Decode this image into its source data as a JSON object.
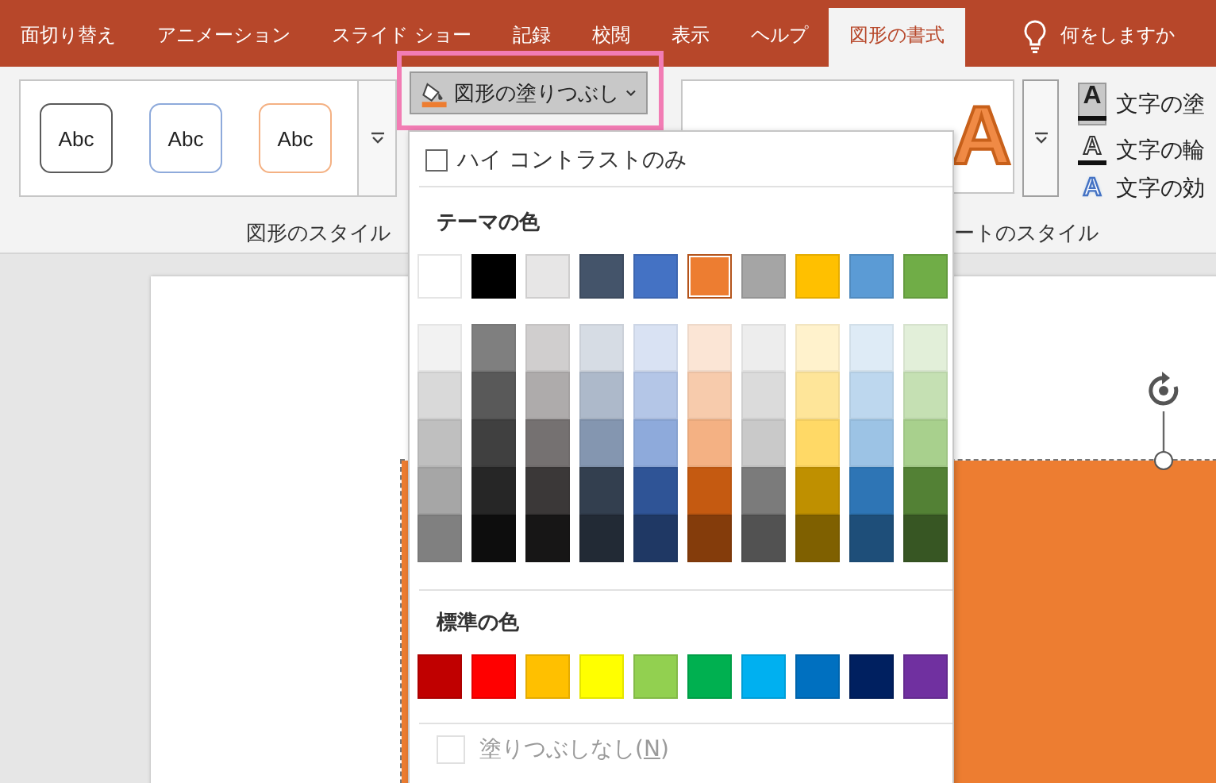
{
  "tabs": [
    {
      "label": "面切り替え",
      "selected": false
    },
    {
      "label": "アニメーション",
      "selected": false
    },
    {
      "label": "スライド ショー",
      "selected": false
    },
    {
      "label": "記録",
      "selected": false
    },
    {
      "label": "校閲",
      "selected": false
    },
    {
      "label": "表示",
      "selected": false
    },
    {
      "label": "ヘルプ",
      "selected": false
    },
    {
      "label": "図形の書式",
      "selected": true
    }
  ],
  "tell_me": {
    "label": "何をしますか"
  },
  "shape_styles": {
    "items": [
      {
        "label": "Abc",
        "color": "#5a5a5a"
      },
      {
        "label": "Abc",
        "color": "#8eaadb"
      },
      {
        "label": "Abc",
        "color": "#f4b183"
      }
    ],
    "group_label": "図形のスタイル"
  },
  "fill_button": {
    "label": "図形の塗りつぶし",
    "expanded": true
  },
  "wordart_styles": {
    "items": [
      {
        "label": "A"
      }
    ],
    "group_label": "ートのスタイル"
  },
  "text_commands": [
    {
      "kind": "fill",
      "glyph": "A",
      "label": "文字の塗"
    },
    {
      "kind": "outline",
      "glyph": "A",
      "label": "文字の輪"
    },
    {
      "kind": "effects",
      "glyph": "A",
      "label": "文字の効"
    }
  ],
  "fill_menu": {
    "high_contrast": {
      "label": "ハイ コントラストのみ",
      "checked": false
    },
    "theme_heading": "テーマの色",
    "theme_colors": [
      {
        "color": "#ffffff",
        "selected": false,
        "shades": [
          {
            "color": "#f2f2f2",
            "selected": false
          },
          {
            "color": "#d9d9d9",
            "selected": false
          },
          {
            "color": "#bfbfbf",
            "selected": false
          },
          {
            "color": "#a6a6a6",
            "selected": false
          },
          {
            "color": "#808080",
            "selected": false
          }
        ]
      },
      {
        "color": "#000000",
        "selected": false,
        "shades": [
          {
            "color": "#7f7f7f",
            "selected": false
          },
          {
            "color": "#595959",
            "selected": false
          },
          {
            "color": "#404040",
            "selected": false
          },
          {
            "color": "#262626",
            "selected": false
          },
          {
            "color": "#0d0d0d",
            "selected": false
          }
        ]
      },
      {
        "color": "#e7e6e6",
        "selected": false,
        "shades": [
          {
            "color": "#d0cece",
            "selected": false
          },
          {
            "color": "#aeabab",
            "selected": false
          },
          {
            "color": "#757171",
            "selected": false
          },
          {
            "color": "#3b3838",
            "selected": false
          },
          {
            "color": "#171616",
            "selected": false
          }
        ]
      },
      {
        "color": "#44546a",
        "selected": false,
        "shades": [
          {
            "color": "#d6dce4",
            "selected": false
          },
          {
            "color": "#adb9ca",
            "selected": false
          },
          {
            "color": "#8496b0",
            "selected": false
          },
          {
            "color": "#333f4f",
            "selected": false
          },
          {
            "color": "#222a35",
            "selected": false
          }
        ]
      },
      {
        "color": "#4472c4",
        "selected": false,
        "shades": [
          {
            "color": "#d9e2f3",
            "selected": false
          },
          {
            "color": "#b4c6e7",
            "selected": false
          },
          {
            "color": "#8eaadb",
            "selected": false
          },
          {
            "color": "#2f5496",
            "selected": false
          },
          {
            "color": "#1f3864",
            "selected": false
          }
        ]
      },
      {
        "color": "#ed7d31",
        "selected": true,
        "shades": [
          {
            "color": "#fbe5d5",
            "selected": false
          },
          {
            "color": "#f7cbac",
            "selected": false
          },
          {
            "color": "#f4b183",
            "selected": false
          },
          {
            "color": "#c55a11",
            "selected": false
          },
          {
            "color": "#843c0b",
            "selected": false
          }
        ]
      },
      {
        "color": "#a5a5a5",
        "selected": false,
        "shades": [
          {
            "color": "#ededed",
            "selected": false
          },
          {
            "color": "#dbdbdb",
            "selected": false
          },
          {
            "color": "#c9c9c9",
            "selected": false
          },
          {
            "color": "#7b7b7b",
            "selected": false
          },
          {
            "color": "#525252",
            "selected": false
          }
        ]
      },
      {
        "color": "#ffc000",
        "selected": false,
        "shades": [
          {
            "color": "#fff2cc",
            "selected": false
          },
          {
            "color": "#fee599",
            "selected": false
          },
          {
            "color": "#ffd966",
            "selected": false
          },
          {
            "color": "#bf9000",
            "selected": false
          },
          {
            "color": "#7f6000",
            "selected": false
          }
        ]
      },
      {
        "color": "#5b9bd5",
        "selected": false,
        "shades": [
          {
            "color": "#deebf6",
            "selected": false
          },
          {
            "color": "#bdd7ee",
            "selected": false
          },
          {
            "color": "#9cc3e5",
            "selected": false
          },
          {
            "color": "#2e75b5",
            "selected": false
          },
          {
            "color": "#1e4e79",
            "selected": false
          }
        ]
      },
      {
        "color": "#70ad47",
        "selected": false,
        "shades": [
          {
            "color": "#e2efd9",
            "selected": false
          },
          {
            "color": "#c5e0b3",
            "selected": false
          },
          {
            "color": "#a8d08d",
            "selected": false
          },
          {
            "color": "#538135",
            "selected": false
          },
          {
            "color": "#375623",
            "selected": false
          }
        ]
      }
    ],
    "standard_heading": "標準の色",
    "standard_colors": [
      {
        "color": "#c00000",
        "selected": false
      },
      {
        "color": "#ff0000",
        "selected": false
      },
      {
        "color": "#ffc000",
        "selected": false
      },
      {
        "color": "#ffff00",
        "selected": false
      },
      {
        "color": "#92d050",
        "selected": false
      },
      {
        "color": "#00b050",
        "selected": false
      },
      {
        "color": "#00b0f0",
        "selected": false
      },
      {
        "color": "#0070c0",
        "selected": false
      },
      {
        "color": "#002060",
        "selected": false
      },
      {
        "color": "#7030a0",
        "selected": false
      }
    ],
    "no_fill": {
      "label_before": "塗りつぶしなし(",
      "access_key": "N",
      "label_after": ")",
      "disabled": true
    }
  },
  "slide": {
    "shape_selected": true
  }
}
